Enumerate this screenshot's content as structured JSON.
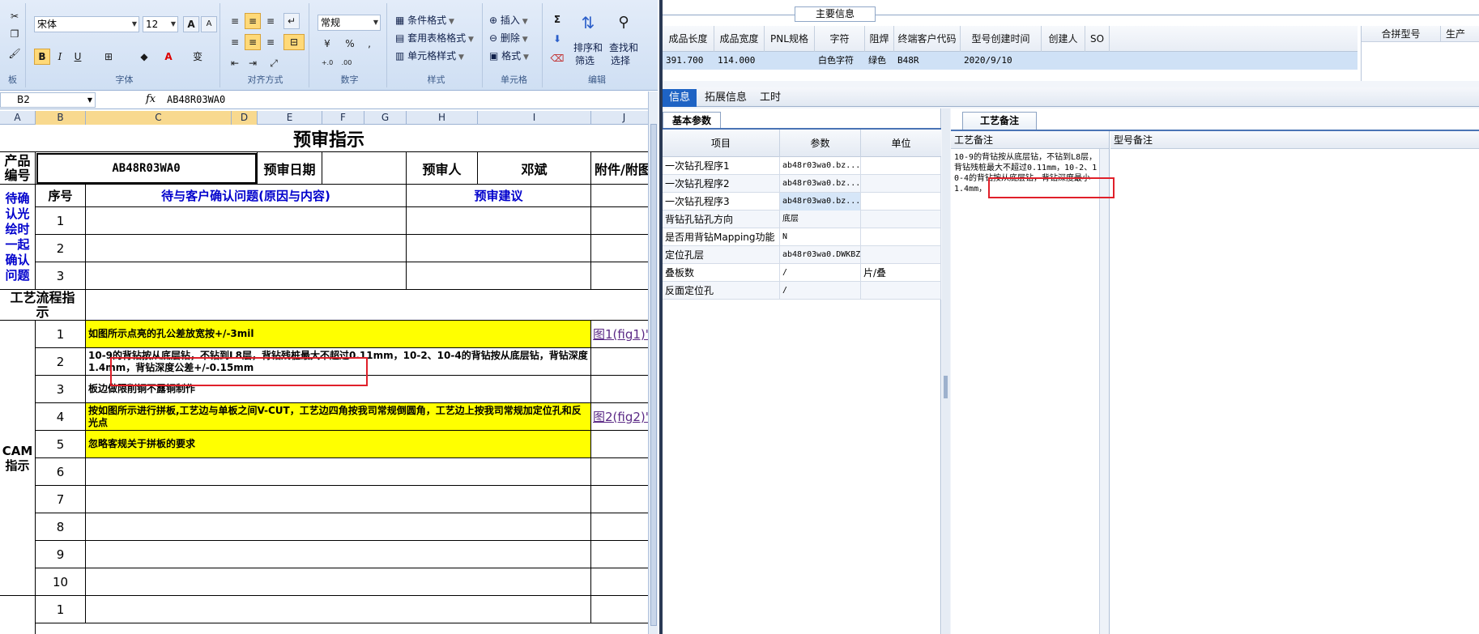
{
  "ribbon": {
    "font_name": "宋体",
    "font_size": "12",
    "number_format": "常规",
    "grow_font": "A",
    "shrink_font": "A",
    "bold": "B",
    "italic": "I",
    "underline": "U",
    "font_color_a": "A",
    "phonetic": "变",
    "percent": "%",
    "comma": ",",
    "currency": "¥",
    "inc_decimal": "+.0",
    "dec_decimal": ".00",
    "cond_format": "条件格式",
    "table_format": "套用表格格式",
    "cell_style": "单元格样式",
    "insert": "插入",
    "delete": "删除",
    "format": "格式",
    "sum": "Σ",
    "sort_filter_1": "排序和",
    "sort_filter_2": "筛选",
    "find_select_1": "查找和",
    "find_select_2": "选择",
    "groups": {
      "clipboard": "板",
      "font": "字体",
      "alignment": "对齐方式",
      "number": "数字",
      "styles": "样式",
      "cells": "单元格",
      "editing": "编辑"
    }
  },
  "formula_bar": {
    "name_box": "B2",
    "fx": "fx",
    "formula": "AB48R03WA0"
  },
  "columns": [
    "A",
    "B",
    "C",
    "D",
    "E",
    "F",
    "G",
    "H",
    "I",
    "J"
  ],
  "sheet": {
    "title": "预审指示",
    "product_label": "产品编号",
    "product_code": "AB48R03WA0",
    "review_date_label": "预审日期",
    "reviewer_label": "预审人",
    "reviewer": "邓斌",
    "attachment_label": "附件/附图",
    "pending_label": "待确认光绘时一起确认问题",
    "seq_label": "序号",
    "question_header": "待与客户确认问题(原因与内容)",
    "suggestion_header": "预审建议",
    "pending_rows": [
      "1",
      "2",
      "3"
    ],
    "process_label": "工艺流程指示",
    "cam_label": "CAM指示",
    "cam_rows": [
      {
        "no": "1",
        "text": "如图所示点亮的孔公差放宽按+/-3mil",
        "link": "图1(fig1)'"
      },
      {
        "no": "2",
        "text": "10-9的背钻按从底层钻，不钻到L8层，背钻残桩最大不超过0.11mm，10-2、10-4的背钻按从底层钻，背钻深度1.4mm，背钻深度公差+/-0.15mm",
        "link": ""
      },
      {
        "no": "3",
        "text": "板边做限削铜不露铜制作",
        "link": ""
      },
      {
        "no": "4",
        "text": "按如图所示进行拼板,工艺边与单板之间V-CUT，工艺边四角按我司常规倒圆角，工艺边上按我司常规加定位孔和反光点",
        "link": "图2(fig2)'"
      },
      {
        "no": "5",
        "text": "忽略客规关于拼板的要求",
        "link": ""
      },
      {
        "no": "6",
        "text": "",
        "link": ""
      },
      {
        "no": "7",
        "text": "",
        "link": ""
      },
      {
        "no": "8",
        "text": "",
        "link": ""
      },
      {
        "no": "9",
        "text": "",
        "link": ""
      },
      {
        "no": "10",
        "text": "",
        "link": ""
      }
    ],
    "next_row": "1"
  },
  "app": {
    "main_info": "主要信息",
    "table_headers": [
      "成品长度",
      "成品宽度",
      "PNL规格",
      "字符",
      "阻焊",
      "终端客户代码",
      "型号创建时间",
      "创建人",
      "SO"
    ],
    "table_row": [
      "391.700",
      "114.000",
      "",
      "白色字符",
      "绿色",
      "B48R",
      "2020/9/10",
      "",
      ""
    ],
    "right_headers": [
      "合拼型号",
      "生产"
    ],
    "tabs": [
      "信息",
      "拓展信息",
      "工时"
    ],
    "params_tab": "基本参数",
    "params_headers": [
      "项目",
      "参数",
      "单位"
    ],
    "params": [
      {
        "item": "一次钻孔程序1",
        "value": "ab48r03wa0.bz...",
        "unit": ""
      },
      {
        "item": "一次钻孔程序2",
        "value": "ab48r03wa0.bz...",
        "unit": ""
      },
      {
        "item": "一次钻孔程序3",
        "value": "ab48r03wa0.bz...",
        "unit": ""
      },
      {
        "item": "背钻孔钻孔方向",
        "value": "底层",
        "unit": ""
      },
      {
        "item": "是否用背钻Mapping功能",
        "value": "N",
        "unit": ""
      },
      {
        "item": "定位孔层",
        "value": "ab48r03wa0.DWKBZ",
        "unit": ""
      },
      {
        "item": "叠板数",
        "value": "/",
        "unit": "片/叠"
      },
      {
        "item": "反面定位孔",
        "value": "/",
        "unit": ""
      }
    ],
    "craft_tab": "工艺备注",
    "craft_header": "工艺备注",
    "type_header": "型号备注",
    "craft_text": "10-9的背钻按从底层钻，不钻到L8层，背钻残桩最大不超过0.11mm，10-2、10-4的背钻按从底层钻，背钻深度最小1.4mm，"
  }
}
